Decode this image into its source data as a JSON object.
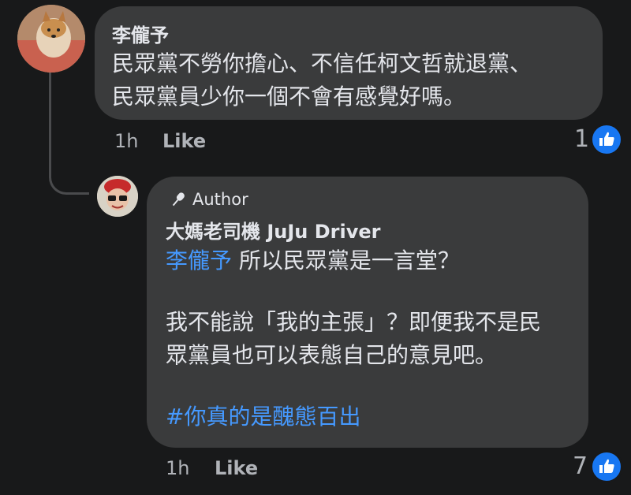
{
  "comment": {
    "author": "李儱予",
    "text_lines": [
      "民眾黨不勞你擔心、不信任柯文哲就退黨、",
      "民眾黨員少你一個不會有感覺好嗎。"
    ],
    "time": "1h",
    "like_label": "Like",
    "reaction_count": "1"
  },
  "reply": {
    "badge": "Author",
    "author": "大媽老司機 JuJu Driver",
    "mention": "李儱予",
    "line1_rest": " 所以民眾黨是一言堂？",
    "para2_lines": [
      "我不能說「我的主張」？即便我不是民",
      "眾黨員也可以表態自己的意見吧。"
    ],
    "hashtag": "#你真的是醜態百出",
    "time": "1h",
    "like_label": "Like",
    "reaction_count": "7"
  },
  "colors": {
    "background": "#18191a",
    "bubble": "#3a3b3c",
    "link": "#4599ff",
    "like_blue": "#1877f2"
  }
}
